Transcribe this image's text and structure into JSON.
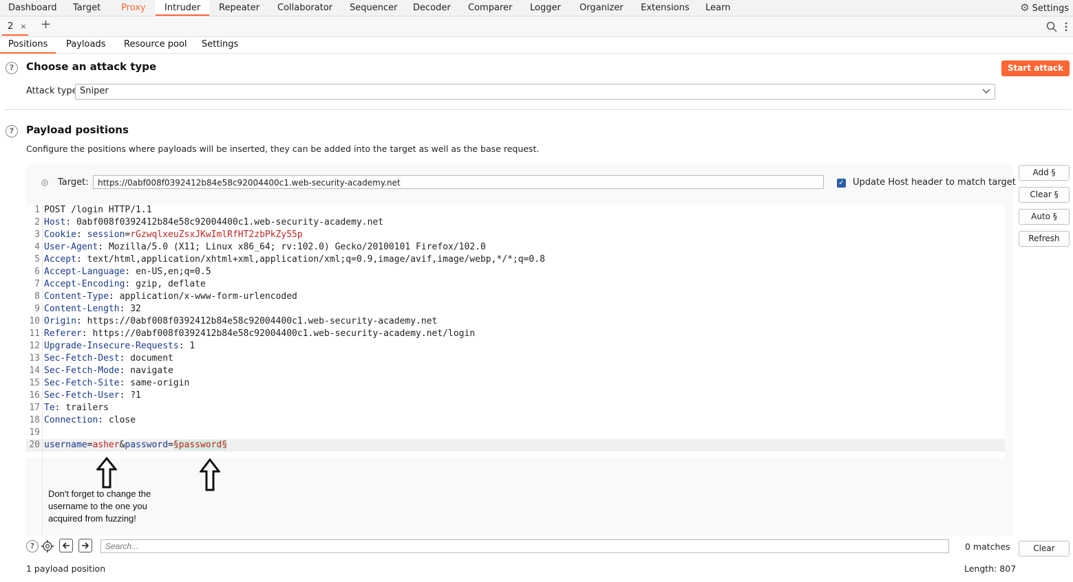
{
  "menu": {
    "items": [
      "Dashboard",
      "Target",
      "Proxy",
      "Intruder",
      "Repeater",
      "Collaborator",
      "Sequencer",
      "Decoder",
      "Comparer",
      "Logger",
      "Organizer",
      "Extensions",
      "Learn"
    ],
    "settings_label": "Settings"
  },
  "tabs": {
    "current": "2",
    "close": "×",
    "add": "+"
  },
  "subtabs": [
    "Positions",
    "Payloads",
    "Resource pool",
    "Settings"
  ],
  "attack": {
    "title": "Choose an attack type",
    "type_label": "Attack type:",
    "type_value": "Sniper",
    "start_button": "Start attack"
  },
  "positions": {
    "title": "Payload positions",
    "description": "Configure the positions where payloads will be inserted, they can be added into the target as well as the base request.",
    "target_label": "Target:",
    "target_value": "https://0abf008f0392412b84e58c92004400c1.web-security-academy.net",
    "update_host_label": "Update Host header to match target",
    "update_host_checked": true,
    "buttons": {
      "add": "Add §",
      "clear": "Clear §",
      "auto": "Auto §",
      "refresh": "Refresh"
    }
  },
  "request": {
    "line1": "POST /login HTTP/1.1",
    "headers": [
      {
        "num": "2",
        "key": "Host",
        "val": "0abf008f0392412b84e58c92004400c1.web-security-academy.net"
      },
      {
        "num": "3",
        "key": "Cookie",
        "val": ""
      },
      {
        "num": "4",
        "key": "User-Agent",
        "val": "Mozilla/5.0 (X11; Linux x86_64; rv:102.0) Gecko/20100101 Firefox/102.0"
      },
      {
        "num": "5",
        "key": "Accept",
        "val": "text/html,application/xhtml+xml,application/xml;q=0.9,image/avif,image/webp,*/*;q=0.8"
      },
      {
        "num": "6",
        "key": "Accept-Language",
        "val": "en-US,en;q=0.5"
      },
      {
        "num": "7",
        "key": "Accept-Encoding",
        "val": "gzip, deflate"
      },
      {
        "num": "8",
        "key": "Content-Type",
        "val": "application/x-www-form-urlencoded"
      },
      {
        "num": "9",
        "key": "Content-Length",
        "val": "32"
      },
      {
        "num": "10",
        "key": "Origin",
        "val": "https://0abf008f0392412b84e58c92004400c1.web-security-academy.net"
      },
      {
        "num": "11",
        "key": "Referer",
        "val": "https://0abf008f0392412b84e58c92004400c1.web-security-academy.net/login"
      },
      {
        "num": "12",
        "key": "Upgrade-Insecure-Requests",
        "val": "1"
      },
      {
        "num": "13",
        "key": "Sec-Fetch-Dest",
        "val": "document"
      },
      {
        "num": "14",
        "key": "Sec-Fetch-Mode",
        "val": "navigate"
      },
      {
        "num": "15",
        "key": "Sec-Fetch-Site",
        "val": "same-origin"
      },
      {
        "num": "16",
        "key": "Sec-Fetch-User",
        "val": "?1"
      },
      {
        "num": "17",
        "key": "Te",
        "val": "trailers"
      },
      {
        "num": "18",
        "key": "Connection",
        "val": "close"
      }
    ],
    "cookie_name": "session",
    "cookie_value": "rGzwqlxeuZsxJKwImlRfHT2zbPkZy55p",
    "body": {
      "username_key": "username",
      "username_val": "asher",
      "password_key": "password",
      "password_val": "§password§"
    }
  },
  "note": {
    "line1": "Don't forget to change the",
    "line2": "username to the one you",
    "line3": "acquired from fuzzing!"
  },
  "search": {
    "placeholder": "Search...",
    "matches": "0 matches",
    "clear": "Clear"
  },
  "footer": {
    "positions_count": "1 payload position",
    "length": "Length: 807"
  }
}
